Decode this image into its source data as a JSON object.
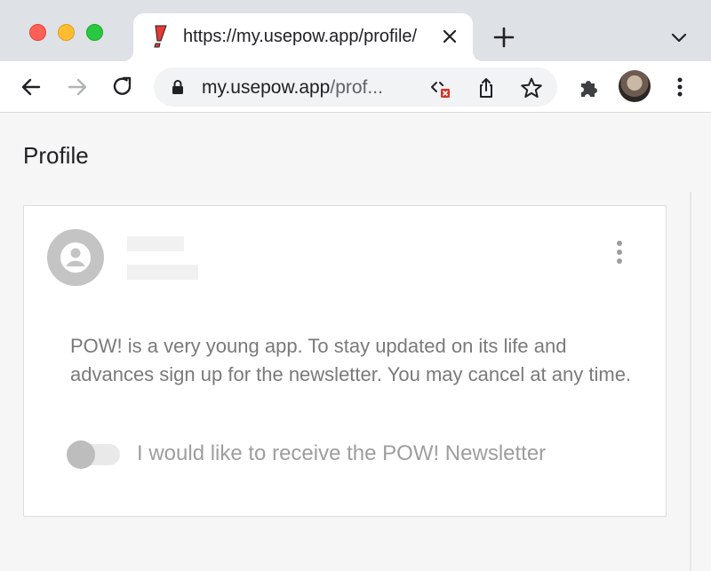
{
  "browser": {
    "tab": {
      "title": "https://my.usepow.app/profile/",
      "favicon": "pow-exclamation-icon"
    },
    "address_bar": {
      "host": "my.usepow.app",
      "path": "/prof..."
    },
    "icons": {
      "back": "back-arrow-icon",
      "forward": "forward-arrow-icon",
      "reload": "reload-icon",
      "lock": "lock-icon",
      "blocked": "code-blocked-icon",
      "share": "share-icon",
      "bookmark": "star-icon",
      "extensions": "puzzle-icon",
      "menu": "kebab-menu-icon"
    },
    "colors": {
      "tab_strip": "#dee1e6",
      "close_red": "#fe5f57",
      "minimize_yellow": "#febc2e",
      "zoom_green": "#28c840",
      "favicon_red": "#e53935"
    }
  },
  "page": {
    "title": "Profile",
    "card": {
      "description": "POW! is a very young app. To stay updated on its life and advances sign up for the newsletter. You may cancel at any time.",
      "newsletter_toggle": {
        "label": "I would like to receive the POW! Newsletter",
        "checked": false
      }
    }
  }
}
